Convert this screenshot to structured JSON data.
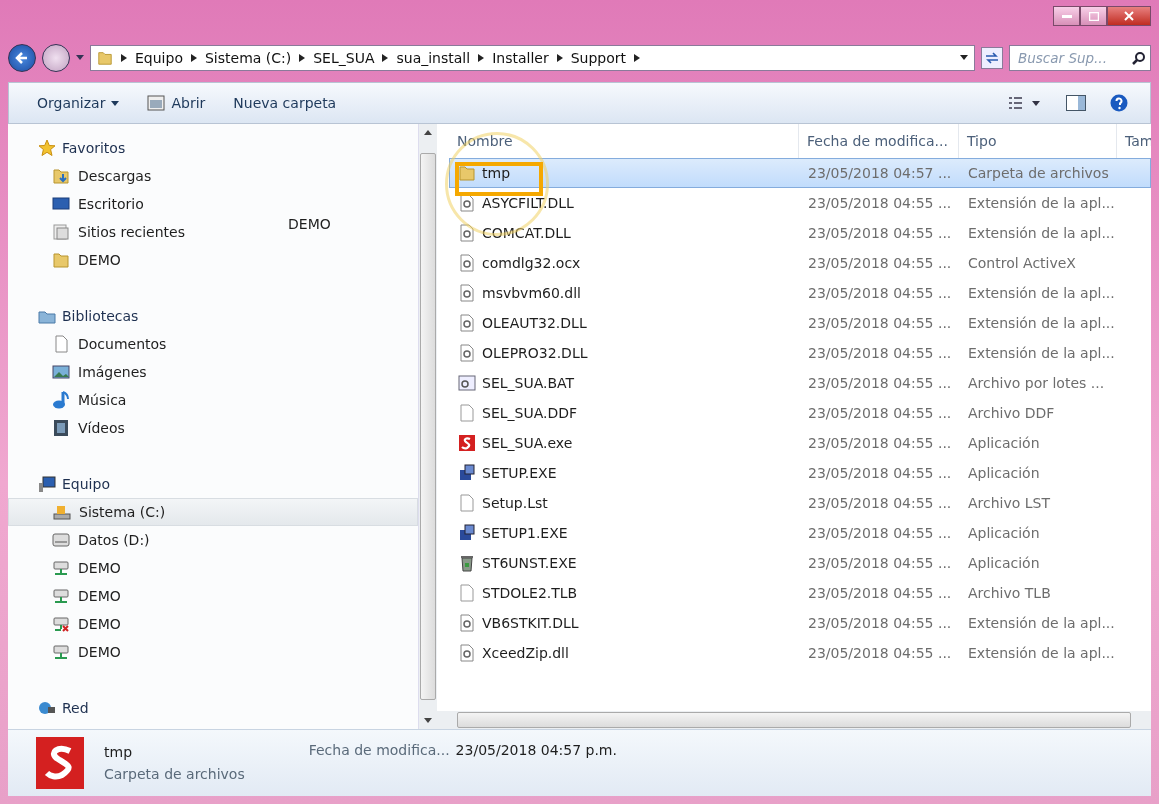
{
  "address_bar": {
    "crumbs": [
      "Equipo",
      "Sistema (C:)",
      "SEL_SUA",
      "sua_install",
      "Installer",
      "Support"
    ]
  },
  "search": {
    "placeholder": "Buscar Sup..."
  },
  "toolbar": {
    "buttons": [
      {
        "label": "Organizar",
        "kind": "menu"
      },
      {
        "label": "Abrir",
        "kind": "icon"
      },
      {
        "label": "Nueva carpeta",
        "kind": "plain"
      }
    ]
  },
  "sidebar": {
    "overlay_label": "DEMO",
    "sections": [
      {
        "label": "Favoritos",
        "items": [
          {
            "label": "Descargas",
            "selected": false
          },
          {
            "label": "Escritorio",
            "selected": false
          },
          {
            "label": "Sitios recientes",
            "selected": false
          },
          {
            "label": "DEMO",
            "selected": false
          }
        ]
      },
      {
        "label": "Bibliotecas",
        "items": [
          {
            "label": "Documentos",
            "selected": false
          },
          {
            "label": "Imágenes",
            "selected": false
          },
          {
            "label": "Música",
            "selected": false
          },
          {
            "label": "Vídeos",
            "selected": false
          }
        ]
      },
      {
        "label": "Equipo",
        "items": [
          {
            "label": "Sistema (C:)",
            "selected": true
          },
          {
            "label": "Datos (D:)",
            "selected": false
          },
          {
            "label": "DEMO",
            "selected": false
          },
          {
            "label": "DEMO",
            "selected": false
          },
          {
            "label": "DEMO",
            "selected": false
          },
          {
            "label": "DEMO",
            "selected": false
          }
        ]
      },
      {
        "label": "Red"
      }
    ]
  },
  "table": {
    "columns": [
      "Nombre",
      "Fecha de modifica...",
      "Tipo",
      "Tam"
    ],
    "rows": [
      {
        "name": "tmp",
        "kind": "folder",
        "date": "23/05/2018 04:57 ...",
        "type": "Carpeta de archivos",
        "selected": true
      },
      {
        "name": "ASYCFILT.DLL",
        "kind": "library",
        "date": "23/05/2018 04:55 ...",
        "type": "Extensión de la apl...",
        "selected": false
      },
      {
        "name": "COMCAT.DLL",
        "kind": "library",
        "date": "23/05/2018 04:55 ...",
        "type": "Extensión de la apl...",
        "selected": false
      },
      {
        "name": "comdlg32.ocx",
        "kind": "library",
        "date": "23/05/2018 04:55 ...",
        "type": "Control ActiveX",
        "selected": false
      },
      {
        "name": "msvbvm60.dll",
        "kind": "library",
        "date": "23/05/2018 04:55 ...",
        "type": "Extensión de la apl...",
        "selected": false
      },
      {
        "name": "OLEAUT32.DLL",
        "kind": "library",
        "date": "23/05/2018 04:55 ...",
        "type": "Extensión de la apl...",
        "selected": false
      },
      {
        "name": "OLEPRO32.DLL",
        "kind": "library",
        "date": "23/05/2018 04:55 ...",
        "type": "Extensión de la apl...",
        "selected": false
      },
      {
        "name": "SEL_SUA.BAT",
        "kind": "batch",
        "date": "23/05/2018 04:55 ...",
        "type": "Archivo por lotes ...",
        "selected": false
      },
      {
        "name": "SEL_SUA.DDF",
        "kind": "plain",
        "date": "23/05/2018 04:55 ...",
        "type": "Archivo DDF",
        "selected": false
      },
      {
        "name": "SEL_SUA.exe",
        "kind": "app",
        "date": "23/05/2018 04:55 ...",
        "type": "Aplicación",
        "selected": false
      },
      {
        "name": "SETUP.EXE",
        "kind": "setup",
        "date": "23/05/2018 04:55 ...",
        "type": "Aplicación",
        "selected": false
      },
      {
        "name": "Setup.Lst",
        "kind": "plain",
        "date": "23/05/2018 04:55 ...",
        "type": "Archivo LST",
        "selected": false
      },
      {
        "name": "SETUP1.EXE",
        "kind": "setup",
        "date": "23/05/2018 04:55 ...",
        "type": "Aplicación",
        "selected": false
      },
      {
        "name": "ST6UNST.EXE",
        "kind": "uninstall",
        "date": "23/05/2018 04:55 ...",
        "type": "Aplicación",
        "selected": false
      },
      {
        "name": "STDOLE2.TLB",
        "kind": "plain",
        "date": "23/05/2018 04:55 ...",
        "type": "Archivo TLB",
        "selected": false
      },
      {
        "name": "VB6STKIT.DLL",
        "kind": "library",
        "date": "23/05/2018 04:55 ...",
        "type": "Extensión de la apl...",
        "selected": false
      },
      {
        "name": "XceedZip.dll",
        "kind": "library",
        "date": "23/05/2018 04:55 ...",
        "type": "Extensión de la apl...",
        "selected": false
      }
    ]
  },
  "details_pane": {
    "name": "tmp",
    "type": "Carpeta de archivos",
    "date_label": "Fecha de modifica...",
    "date_value": "23/05/2018 04:57 p.m."
  }
}
